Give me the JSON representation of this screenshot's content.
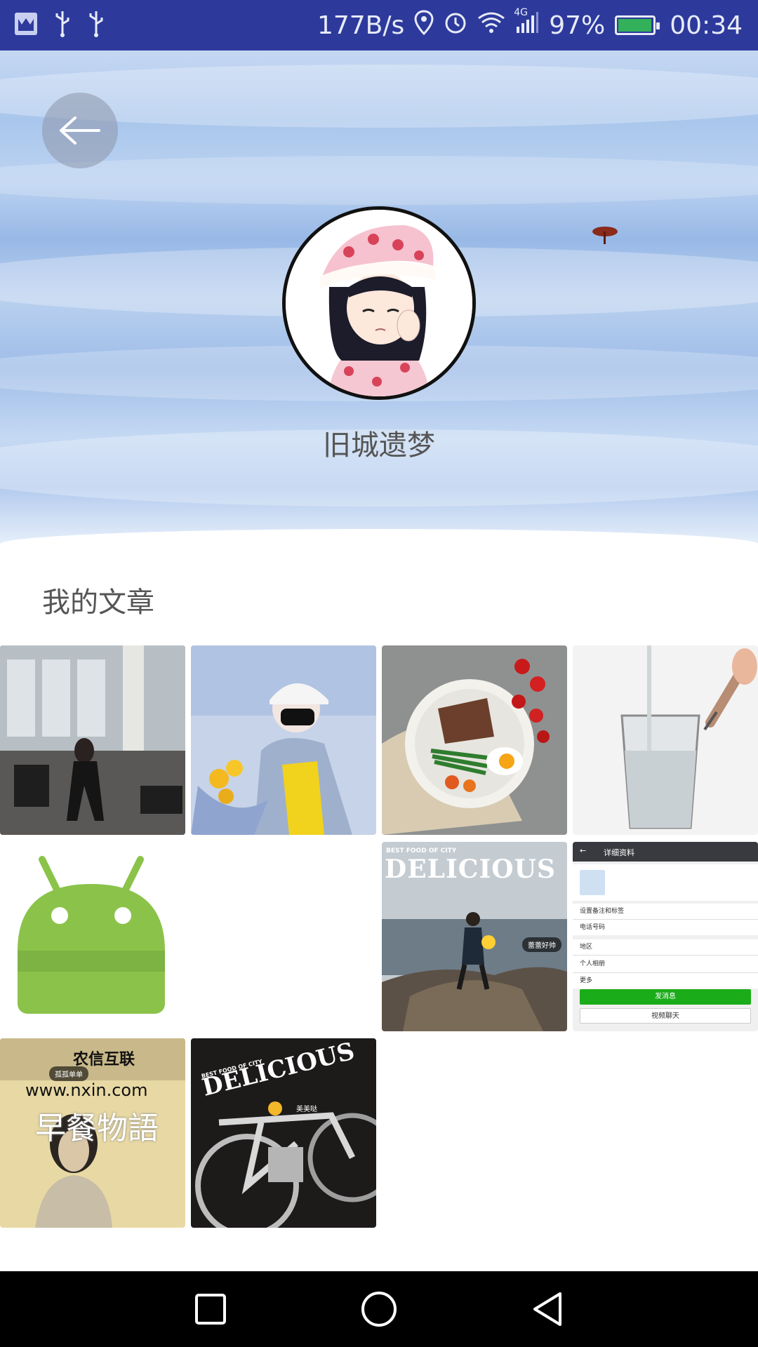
{
  "status_bar": {
    "net_speed": "177B/s",
    "network_type": "4G",
    "battery_percent": "97%",
    "battery_level": 0.97,
    "time": "00:34",
    "icons": [
      "app-notification-icon",
      "usb-icon",
      "usb-icon",
      "location-icon",
      "alarm-icon",
      "wifi-icon",
      "signal-icon",
      "battery-icon"
    ]
  },
  "header": {
    "back_icon": "arrow-left-icon",
    "username": "旧城遗梦"
  },
  "articles": {
    "title": "我的文章",
    "thumbnails": [
      {
        "name": "gym-photo"
      },
      {
        "name": "person-with-flowers-photo"
      },
      {
        "name": "food-plate-photo"
      },
      {
        "name": "water-glass-photo"
      },
      {
        "name": "android-placeholder"
      },
      {
        "name": "delicious-seaside-photo",
        "overlay_small": "BEST FOOD OF CITY",
        "overlay_big": "DELICIOUS",
        "tag": "蕾蕾好帅"
      },
      {
        "name": "profile-screenshot",
        "toolbar": "详细资料",
        "rows": [
          "设置备注和标签",
          "电话号码",
          "地区",
          "个人相册",
          "更多"
        ],
        "btn_primary": "发消息",
        "btn_secondary": "视频聊天"
      },
      {
        "name": "breakfast-photo",
        "logo": "农信互联",
        "url": "www.nxin.com",
        "caption": "早餐物語",
        "tag": "孤孤单单"
      },
      {
        "name": "delicious-bike-photo",
        "overlay_small": "BEST FOOD OF CITY",
        "overlay_big": "DELICIOUS",
        "tag": "美美哒"
      }
    ]
  },
  "nav_bar": {
    "icons": [
      "recents-square-icon",
      "home-circle-icon",
      "back-triangle-icon"
    ]
  },
  "colors": {
    "status_bar": "#2d3a9c",
    "nav_bar": "#000000",
    "android_green": "#8bc34a"
  }
}
